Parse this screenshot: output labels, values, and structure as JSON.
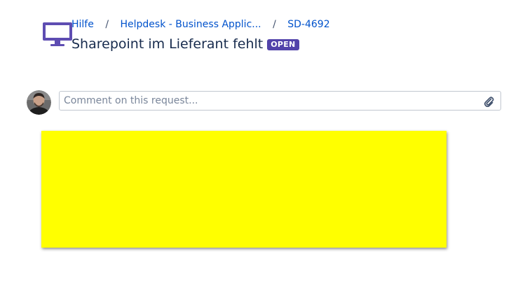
{
  "breadcrumb": {
    "items": [
      {
        "label": "Hilfe"
      },
      {
        "label": "Helpdesk - Business Applic..."
      },
      {
        "label": "SD-4692"
      }
    ],
    "separator": "/"
  },
  "request": {
    "title": "Sharepoint im Lieferant fehlt",
    "status": "OPEN",
    "status_color": "#5243aa",
    "type_icon": "monitor-icon"
  },
  "comment": {
    "placeholder": "Comment on this request...",
    "value": "",
    "attach_icon": "paperclip-icon"
  },
  "colors": {
    "link": "#0052cc",
    "text": "#172b4d",
    "panel": "#ffff00",
    "icon_purple": "#6554c0"
  }
}
